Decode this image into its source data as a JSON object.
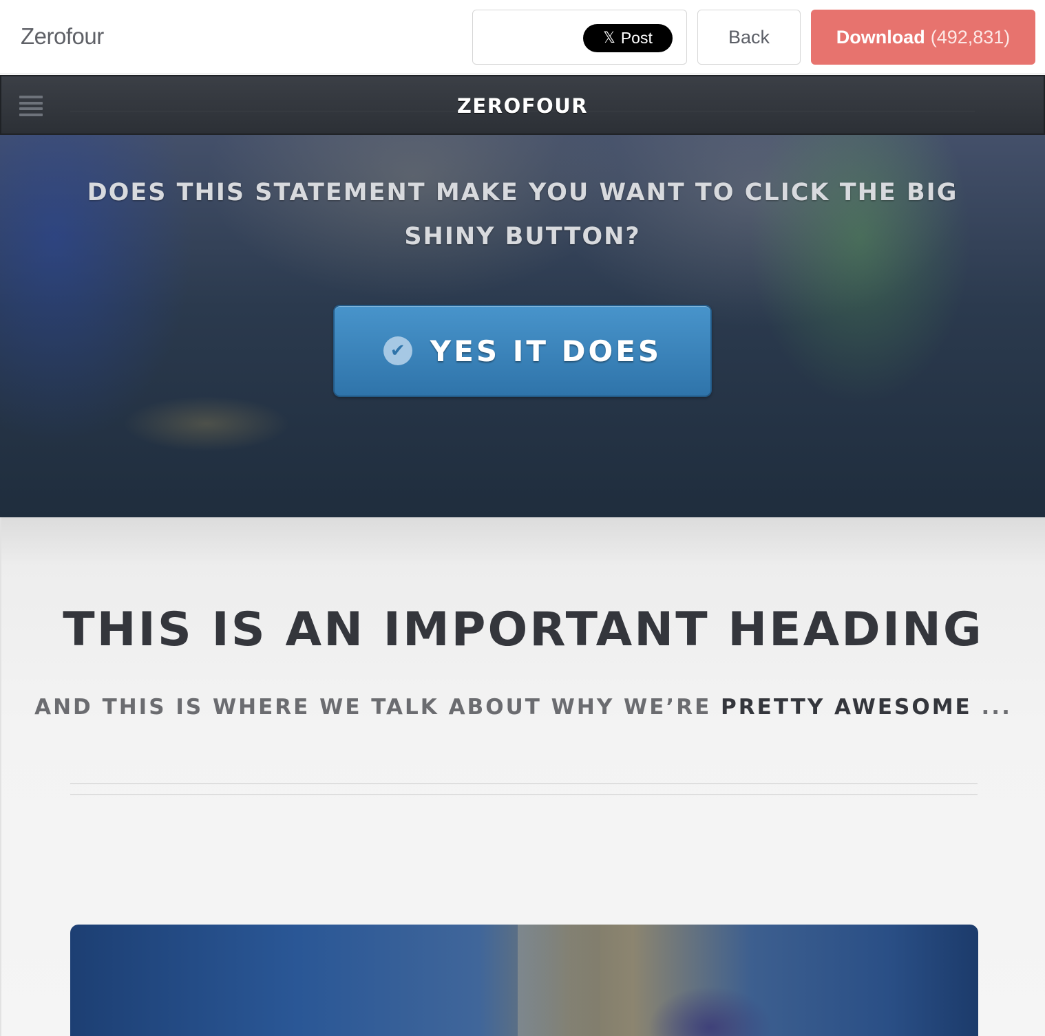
{
  "topbar": {
    "brand": "Zerofour",
    "tweet_label": "Post",
    "tweet_icon": "𝕏",
    "back_label": "Back",
    "download_label": "Download",
    "download_count": "(492,831)"
  },
  "nav": {
    "title": "ZEROFOUR"
  },
  "hero": {
    "statement": "DOES THIS STATEMENT MAKE YOU WANT TO CLICK THE BIG SHINY BUTTON?",
    "button_label": "YES IT DOES",
    "button_icon": "✔"
  },
  "main": {
    "heading": "THIS IS AN IMPORTANT HEADING",
    "sub_prefix": "AND THIS IS WHERE WE TALK ABOUT WHY WE’RE ",
    "sub_strong": "PRETTY AWESOME",
    "sub_suffix": " ..."
  },
  "colors": {
    "download_bg": "#e7736e",
    "cta_blue": "#3a84bc",
    "nav_dark": "#33373d",
    "heading_dark": "#34363c"
  }
}
